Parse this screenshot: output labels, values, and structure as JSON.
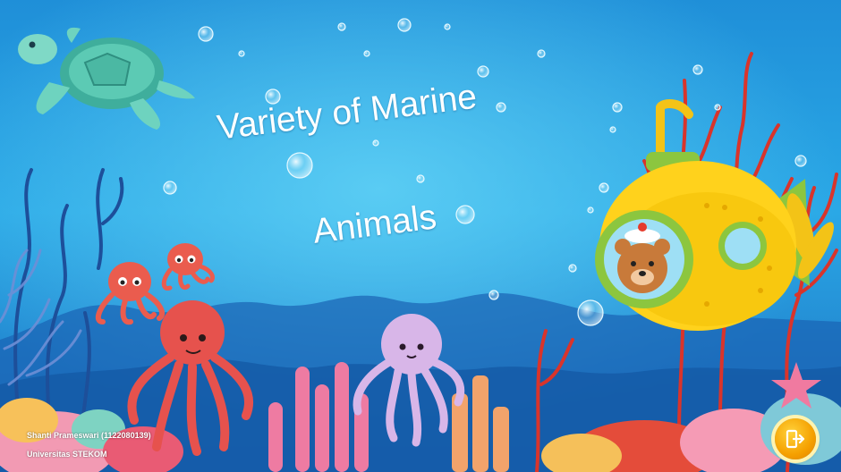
{
  "slide": {
    "title_line1": "Variety of Marine",
    "title_line2": "Animals",
    "author": "Shanti Prameswari (1122080139)",
    "institution": "Universitas STEKOM"
  },
  "navigation": {
    "exit_icon": "exit-door-icon"
  },
  "colors": {
    "ocean_top": "#1f8fd8",
    "ocean_mid": "#2aa8e6",
    "ocean_deep": "#1d6fc0",
    "coral_red": "#e53b2c",
    "submarine_yellow": "#ffd21c",
    "octopus_red": "#e6524d",
    "octopus_lilac": "#d8b6e8",
    "turtle_teal": "#4fc3b0",
    "button_orange": "#f5a000"
  }
}
